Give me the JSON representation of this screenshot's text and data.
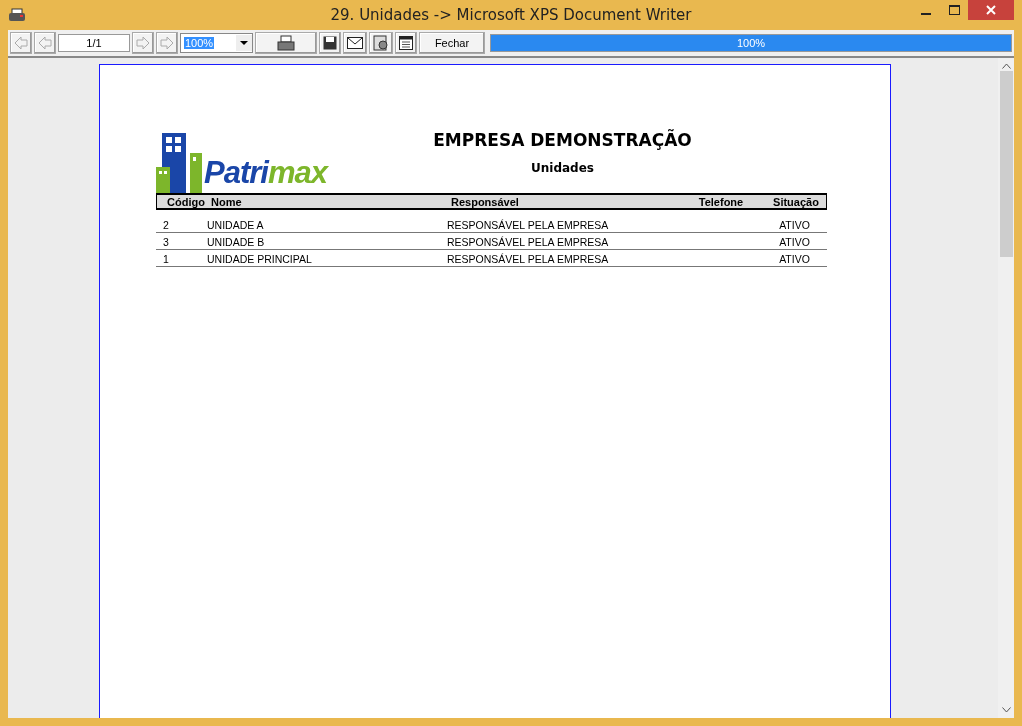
{
  "window": {
    "title": "29. Unidades -> Microsoft XPS Document Writer"
  },
  "toolbar": {
    "page": "1/1",
    "zoom": "100%",
    "close_button": "Fechar",
    "progress": {
      "level": 1,
      "label": "100%"
    }
  },
  "report": {
    "logo_parts": [
      "Patri",
      "max"
    ],
    "company": "EMPRESA DEMONSTRAÇÃO",
    "title": "Unidades",
    "columns": [
      "Código",
      "Nome",
      "Responsável",
      "Telefone",
      "Situação"
    ],
    "rows": [
      [
        "2",
        "UNIDADE A",
        "RESPONSÁVEL PELA EMPRESA",
        "",
        "ATIVO"
      ],
      [
        "3",
        "UNIDADE B",
        "RESPONSÁVEL PELA EMPRESA",
        "",
        "ATIVO"
      ],
      [
        "1",
        "UNIDADE PRINCIPAL",
        "RESPONSÁVEL PELA EMPRESA",
        "",
        "ATIVO"
      ]
    ]
  }
}
